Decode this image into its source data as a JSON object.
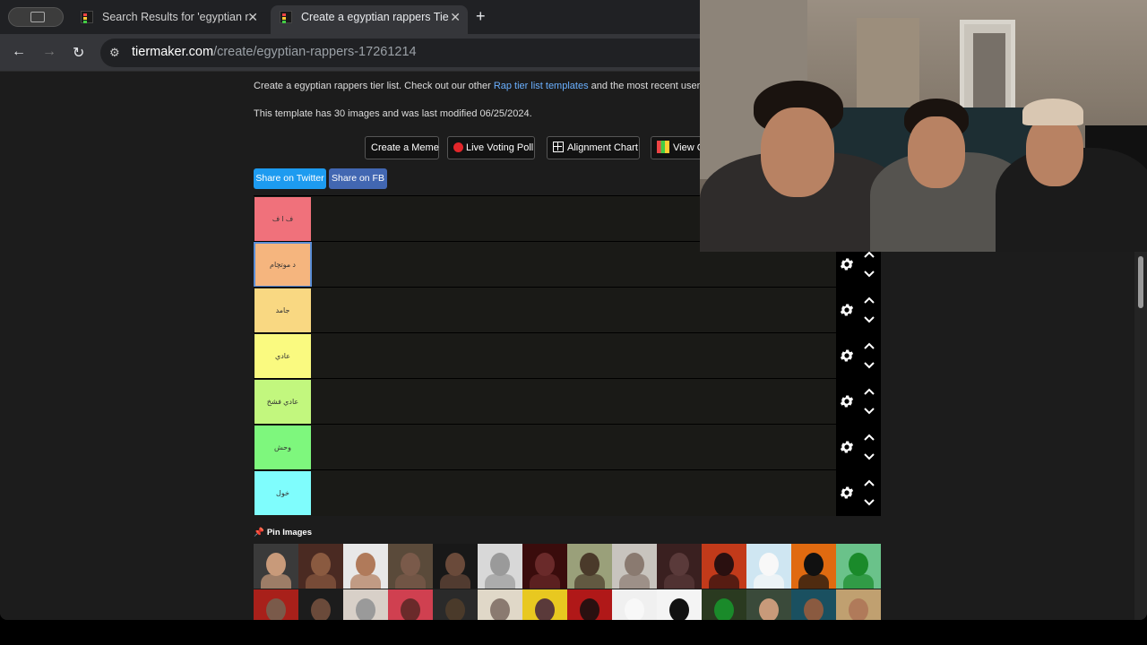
{
  "tabs": [
    {
      "title": "Search Results for 'egyptian r",
      "active": false
    },
    {
      "title": "Create a egyptian rappers Tie",
      "active": true
    }
  ],
  "address": {
    "host": "tiermaker.com",
    "path": "/create/egyptian-rappers-17261214"
  },
  "page": {
    "description_prefix": "Create a egyptian rappers tier list. Check out our other ",
    "description_link": "Rap tier list templates",
    "description_suffix": " and the most recent user sub",
    "info": "This template has 30 images and was last modified 06/25/2024.",
    "buttons": {
      "create_meme": "Create a Meme",
      "live_voting": "Live Voting Poll",
      "alignment_chart": "Alignment Chart",
      "view": "View C"
    },
    "share": {
      "twitter": "Share on Twitter",
      "facebook": "Share on FB"
    },
    "pin_images": "Pin Images"
  },
  "tiers": [
    {
      "label": "ف ا ف",
      "color": "#f0717b"
    },
    {
      "label": "د موتچام",
      "color": "#f5b57e"
    },
    {
      "label": "جامد",
      "color": "#f9d882"
    },
    {
      "label": "عادي",
      "color": "#fafa80"
    },
    {
      "label": "عادي فشخ",
      "color": "#c2f77e"
    },
    {
      "label": "وحش",
      "color": "#7ef77d"
    },
    {
      "label": "خول",
      "color": "#7ffdfd"
    }
  ],
  "colors": {
    "accent_link": "#6ab0ff",
    "twitter": "#1d9bf0",
    "facebook": "#4267b2",
    "selection": "#5a8dd6"
  }
}
